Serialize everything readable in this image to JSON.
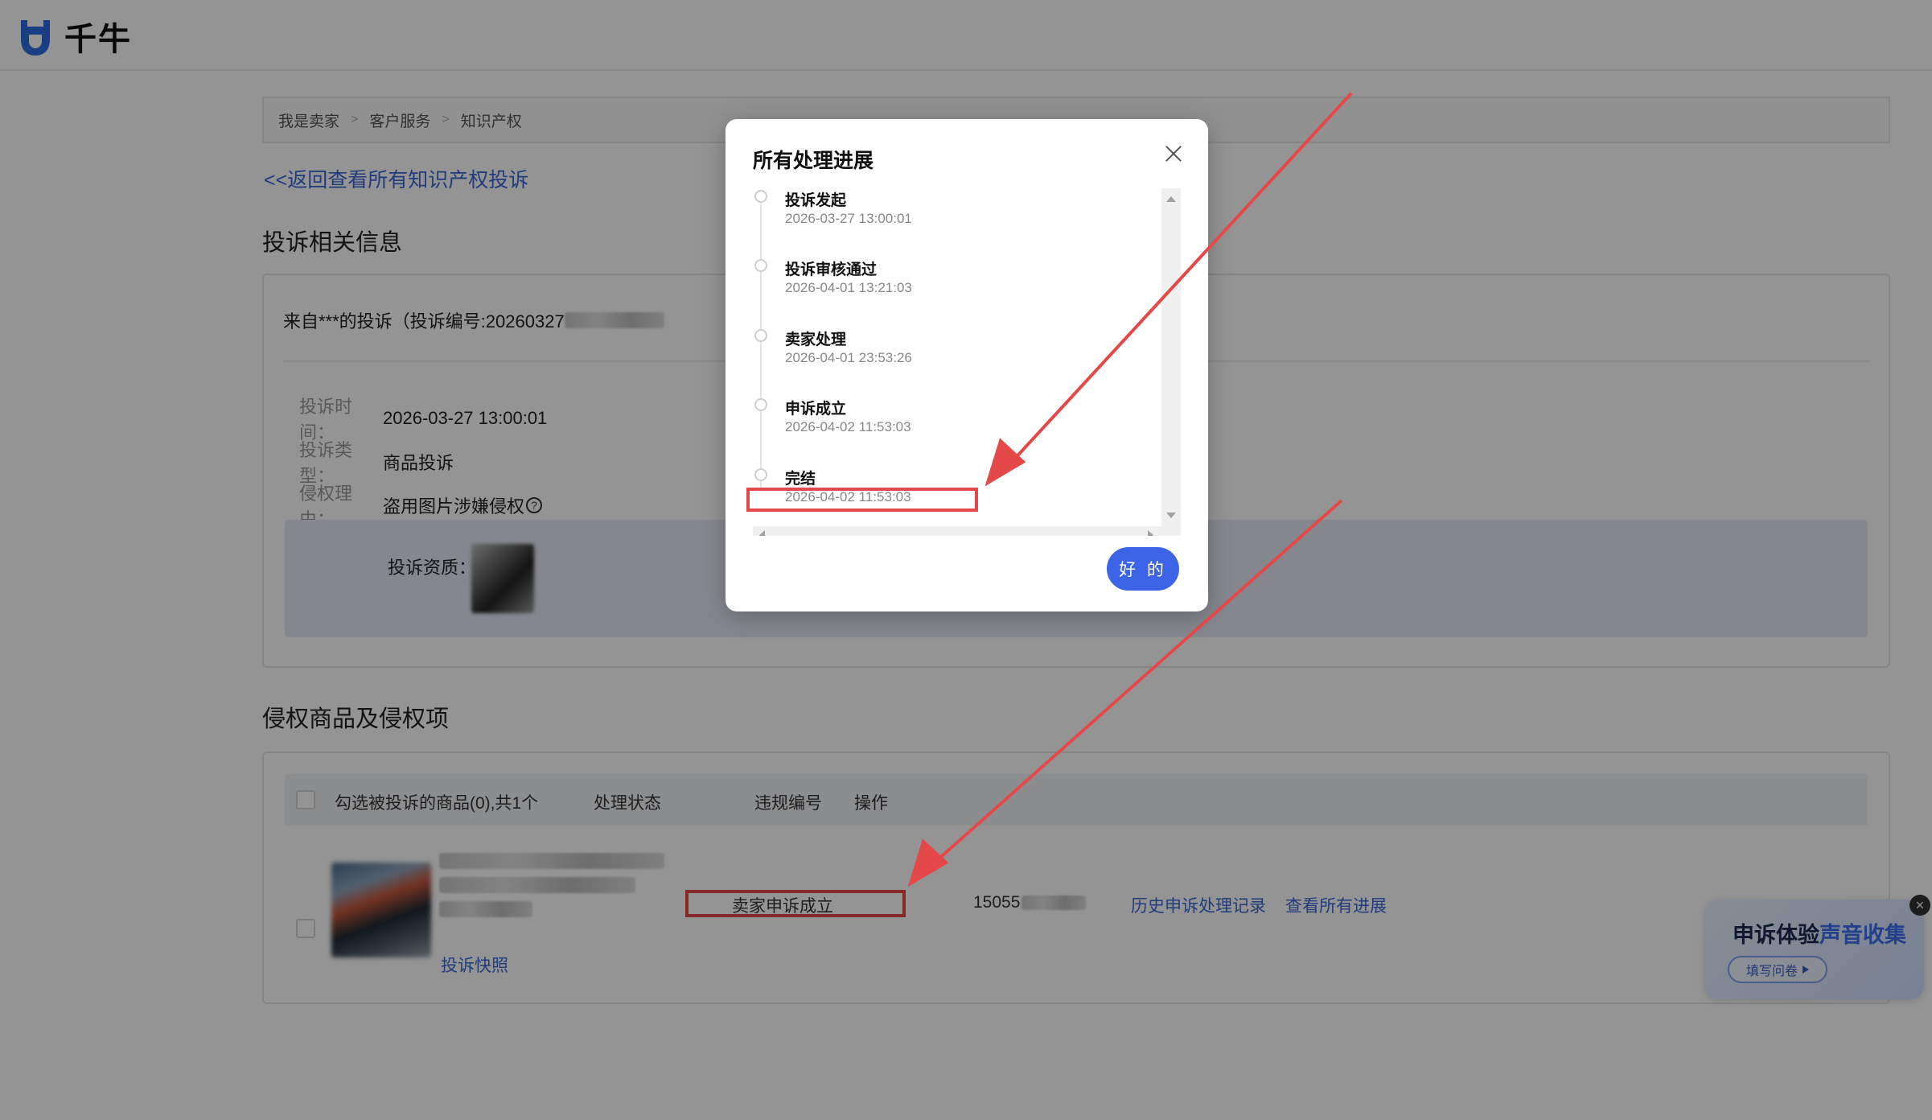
{
  "header": {
    "logo_text": "千牛",
    "logo_icon": "qianniu-logo-icon"
  },
  "breadcrumb": {
    "items": [
      "我是卖家",
      "客户服务",
      "知识产权"
    ],
    "separator": ">"
  },
  "back_link": "<<返回查看所有知识产权投诉",
  "section1": {
    "title": "投诉相关信息",
    "complaint_from": "来自***的投诉（投诉编号:20260327",
    "rows": [
      {
        "label": "投诉时间：",
        "value": "2026-03-27 13:00:01"
      },
      {
        "label": "投诉类型：",
        "value": "商品投诉"
      },
      {
        "label": "侵权理由：",
        "value": "盗用图片涉嫌侵权"
      }
    ],
    "qualification_label": "投诉资质："
  },
  "section2": {
    "title": "侵权商品及侵权项",
    "table": {
      "headers": [
        "勾选被投诉的商品(0),共1个",
        "处理状态",
        "违规编号",
        "操作"
      ],
      "row": {
        "product_link": "投诉快照",
        "status": "卖家申诉成立",
        "violation_no": "15055",
        "actions": [
          "历史申诉处理记录",
          "查看所有进展"
        ]
      }
    }
  },
  "modal": {
    "title": "所有处理进展",
    "timeline": [
      {
        "title": "投诉发起",
        "time": "2026-03-27 13:00:01"
      },
      {
        "title": "投诉审核通过",
        "time": "2026-04-01 13:21:03"
      },
      {
        "title": "卖家处理",
        "time": "2026-04-01 23:53:26"
      },
      {
        "title": "申诉成立",
        "time": "2026-04-02 11:53:03"
      },
      {
        "title": "完结",
        "time": "2026-04-02 11:53:03"
      }
    ],
    "ok_label": "好 的"
  },
  "survey": {
    "title_part1": "申诉体验",
    "title_part2": "声音收集",
    "button_label": "填写问卷",
    "close_label": "×"
  },
  "colors": {
    "accent": "#3d63e6",
    "link": "#3a67d6",
    "annotation": "#e54848"
  }
}
